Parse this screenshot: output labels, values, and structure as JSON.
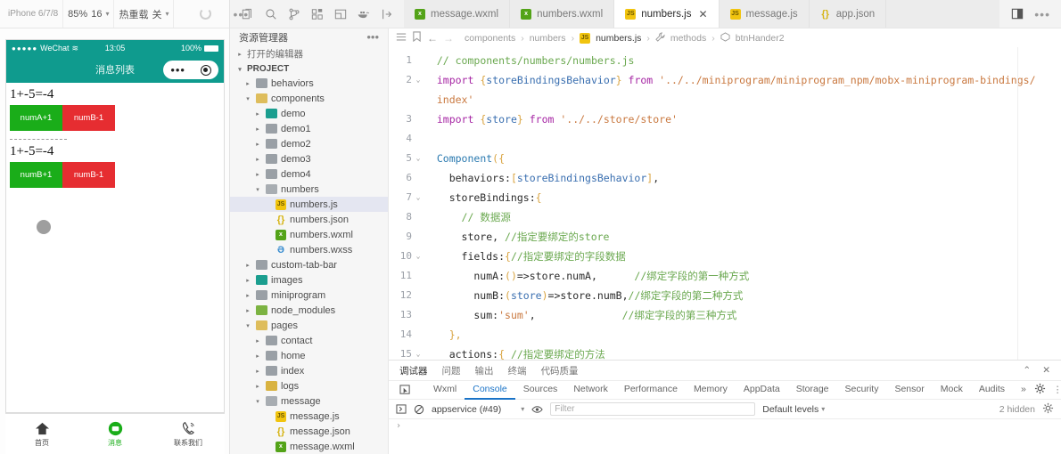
{
  "simulator": {
    "toolbar": {
      "device": "iPhone 6/7/8",
      "scale": "85%",
      "font_size": "16",
      "hot_reload_label": "热重载",
      "hot_reload_value": "关",
      "refresh_icon": "refresh-icon",
      "more_icon": "more-icon"
    },
    "status_bar": {
      "carrier": "WeChat",
      "time": "13:05",
      "battery": "100%"
    },
    "nav_title": "消息列表",
    "content": {
      "line1_sum": "1+-5=-4",
      "row1": [
        {
          "label": "numA+1",
          "color": "#1aad19"
        },
        {
          "label": "numB-1",
          "color": "#e62d31"
        }
      ],
      "line2_sum": "1+-5=-4",
      "row2": [
        {
          "label": "numB+1",
          "color": "#1aad19"
        },
        {
          "label": "numB-1",
          "color": "#e62d31"
        }
      ]
    },
    "tabbar": [
      {
        "label": "首页",
        "icon": "home-icon",
        "active": false
      },
      {
        "label": "消息",
        "icon": "chat-bubble-icon",
        "active": true
      },
      {
        "label": "联系我们",
        "icon": "phone-icon",
        "active": false
      }
    ]
  },
  "ide": {
    "activity_icons": [
      "files-icon",
      "search-icon",
      "source-control-icon",
      "extensions-icon",
      "layout-icon",
      "docker-icon",
      "debug-icon"
    ],
    "tabs": [
      {
        "label": "message.wxml",
        "type": "wxml",
        "active": false
      },
      {
        "label": "numbers.wxml",
        "type": "wxml",
        "active": false
      },
      {
        "label": "numbers.js",
        "type": "js",
        "active": true
      },
      {
        "label": "message.js",
        "type": "js",
        "active": false
      },
      {
        "label": "app.json",
        "type": "json",
        "active": false
      }
    ],
    "tab_close_label": "✕",
    "tabs_right_icons": [
      "split-editor-icon",
      "more-icon"
    ],
    "explorer": {
      "title": "资源管理器",
      "more_icon": "more-icon",
      "open_editors": "打开的编辑器",
      "project": "PROJECT",
      "tree": [
        {
          "label": "behaviors",
          "depth": 1,
          "kind": "folder",
          "color": "gray",
          "arrow": "▸"
        },
        {
          "label": "components",
          "depth": 1,
          "kind": "folder-open",
          "color": "yellow",
          "arrow": "▾"
        },
        {
          "label": "demo",
          "depth": 2,
          "kind": "folder",
          "color": "teal",
          "arrow": "▸"
        },
        {
          "label": "demo1",
          "depth": 2,
          "kind": "folder",
          "color": "gray",
          "arrow": "▸"
        },
        {
          "label": "demo2",
          "depth": 2,
          "kind": "folder",
          "color": "gray",
          "arrow": "▸"
        },
        {
          "label": "demo3",
          "depth": 2,
          "kind": "folder",
          "color": "gray",
          "arrow": "▸"
        },
        {
          "label": "demo4",
          "depth": 2,
          "kind": "folder",
          "color": "gray",
          "arrow": "▸"
        },
        {
          "label": "numbers",
          "depth": 2,
          "kind": "folder-open",
          "color": "gray",
          "arrow": "▾"
        },
        {
          "label": "numbers.js",
          "depth": 3,
          "kind": "file-js",
          "selected": true,
          "arrow": ""
        },
        {
          "label": "numbers.json",
          "depth": 3,
          "kind": "file-json",
          "arrow": ""
        },
        {
          "label": "numbers.wxml",
          "depth": 3,
          "kind": "file-wxml",
          "arrow": ""
        },
        {
          "label": "numbers.wxss",
          "depth": 3,
          "kind": "file-wxss",
          "arrow": ""
        },
        {
          "label": "custom-tab-bar",
          "depth": 1,
          "kind": "folder",
          "color": "gray",
          "arrow": "▸"
        },
        {
          "label": "images",
          "depth": 1,
          "kind": "folder",
          "color": "teal",
          "arrow": "▸"
        },
        {
          "label": "miniprogram",
          "depth": 1,
          "kind": "folder",
          "color": "gray",
          "arrow": "▸"
        },
        {
          "label": "node_modules",
          "depth": 1,
          "kind": "folder",
          "color": "green",
          "arrow": "▸"
        },
        {
          "label": "pages",
          "depth": 1,
          "kind": "folder-open",
          "color": "yellow",
          "arrow": "▾"
        },
        {
          "label": "contact",
          "depth": 2,
          "kind": "folder",
          "color": "gray",
          "arrow": "▸"
        },
        {
          "label": "home",
          "depth": 2,
          "kind": "folder",
          "color": "gray",
          "arrow": "▸"
        },
        {
          "label": "index",
          "depth": 2,
          "kind": "folder",
          "color": "gray",
          "arrow": "▸"
        },
        {
          "label": "logs",
          "depth": 2,
          "kind": "folder",
          "color": "yellow",
          "arrow": "▸"
        },
        {
          "label": "message",
          "depth": 2,
          "kind": "folder-open",
          "color": "gray",
          "arrow": "▾"
        },
        {
          "label": "message.js",
          "depth": 3,
          "kind": "file-js",
          "arrow": ""
        },
        {
          "label": "message.json",
          "depth": 3,
          "kind": "file-json",
          "arrow": ""
        },
        {
          "label": "message.wxml",
          "depth": 3,
          "kind": "file-wxml",
          "arrow": ""
        }
      ]
    },
    "breadcrumb": {
      "icons": [
        "outline-icon",
        "bookmark-icon",
        "back-arrow-icon",
        "forward-arrow-icon"
      ],
      "items": [
        "components",
        "numbers",
        "numbers.js",
        "methods",
        "btnHander2"
      ],
      "separator": "›",
      "file_icon": "js-file-icon",
      "method_icon": "wrench-icon",
      "symbol_icon": "cube-icon"
    },
    "code": [
      {
        "n": "1",
        "fold": "",
        "parts": [
          {
            "t": "  ",
            "c": "pl"
          },
          {
            "t": "// components/numbers/numbers.js",
            "c": "cm"
          }
        ]
      },
      {
        "n": "2",
        "fold": "⌄",
        "parts": [
          {
            "t": "  ",
            "c": "pl"
          },
          {
            "t": "import ",
            "c": "kw"
          },
          {
            "t": "{",
            "c": "br"
          },
          {
            "t": "storeBindingsBehavior",
            "c": "id"
          },
          {
            "t": "}",
            "c": "br"
          },
          {
            "t": " from ",
            "c": "kw"
          },
          {
            "t": "'../../miniprogram/miniprogram_npm/mobx-miniprogram-bindings/",
            "c": "st"
          }
        ]
      },
      {
        "n": "",
        "fold": "",
        "parts": [
          {
            "t": "  ",
            "c": "pl"
          },
          {
            "t": "index'",
            "c": "st"
          }
        ]
      },
      {
        "n": "3",
        "fold": "",
        "parts": [
          {
            "t": "  ",
            "c": "pl"
          },
          {
            "t": "import ",
            "c": "kw"
          },
          {
            "t": "{",
            "c": "br"
          },
          {
            "t": "store",
            "c": "id"
          },
          {
            "t": "}",
            "c": "br"
          },
          {
            "t": " from ",
            "c": "kw"
          },
          {
            "t": "'../../store/store'",
            "c": "st"
          }
        ]
      },
      {
        "n": "4",
        "fold": "",
        "parts": [
          {
            "t": "",
            "c": "pl"
          }
        ]
      },
      {
        "n": "5",
        "fold": "⌄",
        "parts": [
          {
            "t": "  ",
            "c": "pl"
          },
          {
            "t": "Component",
            "c": "fn"
          },
          {
            "t": "({",
            "c": "br"
          }
        ]
      },
      {
        "n": "6",
        "fold": "",
        "parts": [
          {
            "t": "    behaviors:",
            "c": "pl"
          },
          {
            "t": "[",
            "c": "br"
          },
          {
            "t": "storeBindingsBehavior",
            "c": "id"
          },
          {
            "t": "]",
            "c": "br"
          },
          {
            "t": ",",
            "c": "pl"
          }
        ]
      },
      {
        "n": "7",
        "fold": "⌄",
        "parts": [
          {
            "t": "    storeBindings:",
            "c": "pl"
          },
          {
            "t": "{",
            "c": "br"
          }
        ]
      },
      {
        "n": "8",
        "fold": "",
        "parts": [
          {
            "t": "      ",
            "c": "pl"
          },
          {
            "t": "// 数据源",
            "c": "cm"
          }
        ]
      },
      {
        "n": "9",
        "fold": "",
        "parts": [
          {
            "t": "      store, ",
            "c": "pl"
          },
          {
            "t": "//指定要绑定的store",
            "c": "cm"
          }
        ]
      },
      {
        "n": "10",
        "fold": "⌄",
        "parts": [
          {
            "t": "      fields:",
            "c": "pl"
          },
          {
            "t": "{",
            "c": "br"
          },
          {
            "t": "//指定要绑定的字段数据",
            "c": "cm"
          }
        ]
      },
      {
        "n": "11",
        "fold": "",
        "parts": [
          {
            "t": "        numA:",
            "c": "pl"
          },
          {
            "t": "()",
            "c": "br"
          },
          {
            "t": "=>store.numA,",
            "c": "pl"
          },
          {
            "t": "      //绑定字段的第一种方式",
            "c": "cm"
          }
        ]
      },
      {
        "n": "12",
        "fold": "",
        "parts": [
          {
            "t": "        numB:",
            "c": "pl"
          },
          {
            "t": "(",
            "c": "br"
          },
          {
            "t": "store",
            "c": "id"
          },
          {
            "t": ")",
            "c": "br"
          },
          {
            "t": "=>store.numB,",
            "c": "pl"
          },
          {
            "t": "//绑定字段的第二种方式",
            "c": "cm"
          }
        ]
      },
      {
        "n": "13",
        "fold": "",
        "parts": [
          {
            "t": "        sum:",
            "c": "pl"
          },
          {
            "t": "'sum'",
            "c": "st"
          },
          {
            "t": ",",
            "c": "pl"
          },
          {
            "t": "              //绑定字段的第三种方式",
            "c": "cm"
          }
        ]
      },
      {
        "n": "14",
        "fold": "",
        "parts": [
          {
            "t": "    ",
            "c": "pl"
          },
          {
            "t": "},",
            "c": "br"
          }
        ]
      },
      {
        "n": "15",
        "fold": "⌄",
        "parts": [
          {
            "t": "    actions:",
            "c": "pl"
          },
          {
            "t": "{",
            "c": "br"
          },
          {
            "t": " //指定要绑定的方法",
            "c": "cm"
          }
        ]
      }
    ],
    "devpanel": {
      "panel_tabs": [
        "调试器",
        "问题",
        "输出",
        "终端",
        "代码质量"
      ],
      "panel_tabs_active": "调试器",
      "panel_right_icons": [
        "chevron-up-icon",
        "close-icon"
      ],
      "devtools_tabs": [
        "Wxml",
        "Console",
        "Sources",
        "Network",
        "Performance",
        "Memory",
        "AppData",
        "Storage",
        "Security",
        "Sensor",
        "Mock",
        "Audits"
      ],
      "devtools_active": "Console",
      "overflow_label": "»",
      "inspect_icon": "inspect-icon",
      "settings_icon": "gear-icon",
      "kebab_icon": "more-vertical-icon",
      "dock_icon": "dock-icon",
      "toolbar": {
        "sidebar_icon": "sidebar-icon",
        "clear_icon": "clear-console-icon",
        "context": "appservice (#49)",
        "context_caret": "▾",
        "eye_icon": "eye-icon",
        "filter_placeholder": "Filter",
        "levels": "Default levels",
        "levels_caret": "▾",
        "hidden_count": "2 hidden",
        "gear_icon": "gear-icon"
      },
      "prompt": "›"
    }
  }
}
